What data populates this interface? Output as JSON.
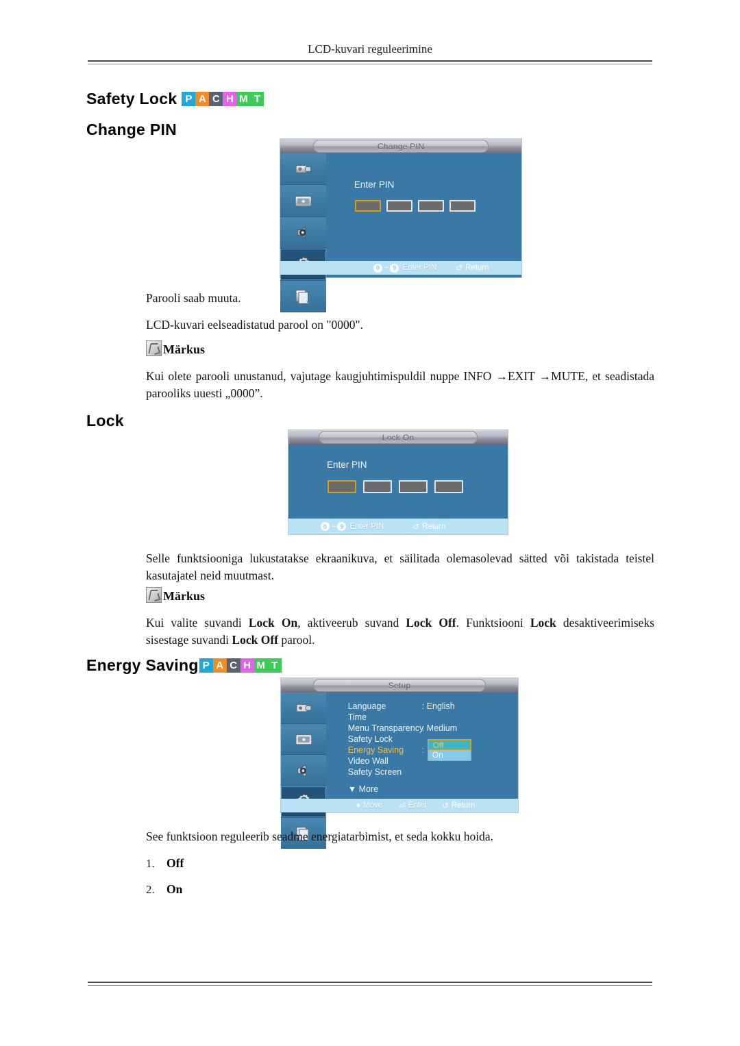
{
  "header": {
    "running_head": "LCD-kuvari reguleerimine"
  },
  "badge": {
    "letters": [
      "P",
      "A",
      "C",
      "H",
      "M",
      "T"
    ],
    "colors": [
      "#22a8d8",
      "#f28c28",
      "#5a6170",
      "#e463e8",
      "#3ecb5a",
      "#3ecb5a"
    ]
  },
  "sections": [
    {
      "id": "safety-lock",
      "heading": "Safety Lock",
      "has_badge": true,
      "subheading": "Change PIN",
      "osd": {
        "title": "Change PIN",
        "prompt": "Enter PIN",
        "pin_digits": 4,
        "footer": {
          "key_from": "0",
          "key_to": "9",
          "tilde": "~",
          "action": "Enter PIN",
          "return_icon": "↺",
          "return": "Return"
        }
      },
      "paragraphs": [
        "Parooli saab muuta.",
        "LCD-kuvari eelseadistatud parool on \"0000\"."
      ],
      "note_label": "Märkus",
      "note_text": "Kui olete parooli unustanud, vajutage kaugjuhtimispuldil nuppe INFO →EXIT →MUTE, et seadistada parooliks uuesti „0000”."
    },
    {
      "id": "lock",
      "heading": "Lock",
      "has_badge": false,
      "osd": {
        "title": "Lock On",
        "prompt": "Enter PIN",
        "pin_digits": 4,
        "footer": {
          "key_from": "0",
          "key_to": "9",
          "tilde": "~",
          "action": "Enter PIN",
          "return_icon": "↺",
          "return": "Return"
        }
      },
      "paragraphs": [
        "Selle funktsiooniga lukustatakse ekraanikuva, et säilitada olemasolevad sätted või takistada teistel kasutajatel neid muutmast."
      ],
      "note_label": "Märkus",
      "note_text_html": "Kui valite suvandi <b>Lock On</b>, aktiveerub suvand <b>Lock Off</b>. Funktsiooni <b>Lock</b> desaktiveerimiseks sisestage suvandi <b>Lock Off</b> parool."
    },
    {
      "id": "energy-saving",
      "heading": "Energy Saving",
      "has_badge": true,
      "osd": {
        "title": "Setup",
        "rows": [
          {
            "name": "Language",
            "value": ": English",
            "highlight": false
          },
          {
            "name": "Time",
            "value": "",
            "highlight": false
          },
          {
            "name": "Menu Transparency",
            "value": ": Medium",
            "highlight": false
          },
          {
            "name": "Safety Lock",
            "value": "",
            "highlight": false
          },
          {
            "name": "Energy Saving",
            "value": ":",
            "highlight": true
          },
          {
            "name": "Video Wall",
            "value": "",
            "highlight": false
          },
          {
            "name": "Safety Screen",
            "value": "",
            "highlight": false
          }
        ],
        "more": "▼ More",
        "dropdown": {
          "selected": "Off",
          "other": "On"
        },
        "footer": {
          "move_icon": "♦",
          "move": "Move",
          "enter_icon": "⏎",
          "enter": "Enter",
          "return_icon": "↺",
          "return": "Return"
        }
      },
      "paragraphs": [
        "See funktsioon reguleerib seadme energiatarbimist, et seda kokku hoida."
      ],
      "list": [
        {
          "num": "1.",
          "value": "Off"
        },
        {
          "num": "2.",
          "value": "On"
        }
      ]
    }
  ]
}
